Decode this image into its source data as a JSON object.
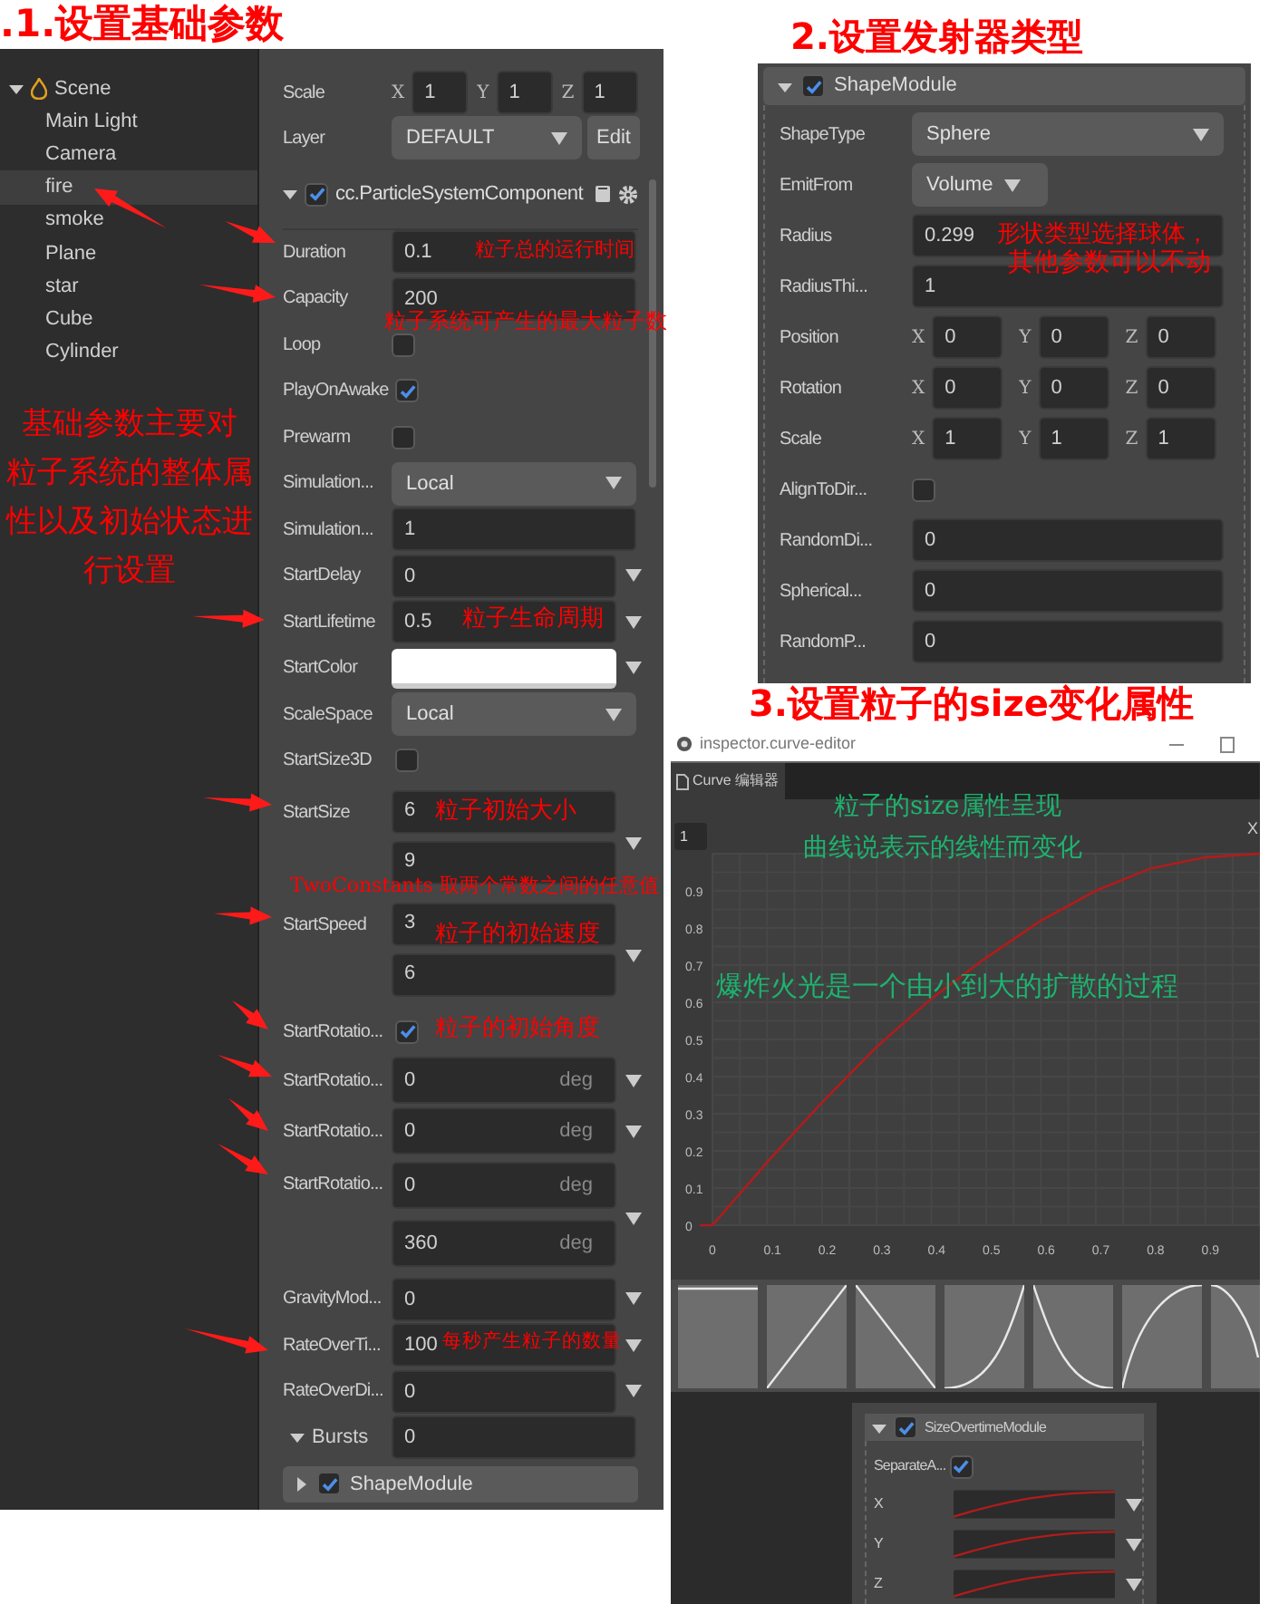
{
  "basic": {
    "title": ".1.设置基础参数",
    "hierarchy": {
      "label": "Scene",
      "expanded": true,
      "children": [
        {
          "label": "Main Light",
          "selected": false
        },
        {
          "label": "Camera",
          "selected": false
        },
        {
          "label": "fire",
          "selected": true
        },
        {
          "label": "smoke",
          "selected": false
        },
        {
          "label": "Plane",
          "selected": false
        },
        {
          "label": "star",
          "selected": false
        },
        {
          "label": "Cube",
          "selected": false
        },
        {
          "label": "Cylinder",
          "selected": false
        }
      ]
    },
    "inspector": {
      "top_rows": [
        {
          "kind": "vector",
          "label": "Scale",
          "axes": [
            {
              "axis": "X",
              "value": "1"
            },
            {
              "axis": "Y",
              "value": "1"
            },
            {
              "axis": "Z",
              "value": "1"
            }
          ]
        },
        {
          "kind": "select",
          "label": "Layer",
          "value": "DEFAULT",
          "button": "Edit"
        }
      ],
      "component": {
        "name": "cc.ParticleSystemComponent",
        "enabled": true,
        "expanded": true
      },
      "rows": [
        {
          "kind": "number",
          "label": "Duration",
          "value": "0.1"
        },
        {
          "kind": "number",
          "label": "Capacity",
          "value": "200"
        },
        {
          "kind": "checkbox",
          "label": "Loop",
          "checked": false
        },
        {
          "kind": "checkbox",
          "label": "PlayOnAwake",
          "checked": true
        },
        {
          "kind": "checkbox",
          "label": "Prewarm",
          "checked": false
        },
        {
          "kind": "select",
          "label": "Simulation...",
          "value": "Local"
        },
        {
          "kind": "number",
          "label": "Simulation...",
          "value": "1"
        },
        {
          "kind": "menu",
          "label": "StartDelay",
          "values": [
            "0"
          ]
        },
        {
          "kind": "menu",
          "label": "StartLifetime",
          "values": [
            "0.5"
          ]
        },
        {
          "kind": "color",
          "label": "StartColor",
          "color": "#ffffff"
        },
        {
          "kind": "select",
          "label": "ScaleSpace",
          "value": "Local"
        },
        {
          "kind": "checkbox",
          "label": "StartSize3D",
          "checked": false
        },
        {
          "kind": "menu",
          "label": "StartSize",
          "values": [
            "6",
            "9"
          ]
        },
        {
          "kind": "menu",
          "label": "StartSpeed",
          "values": [
            "3",
            "6"
          ]
        },
        {
          "kind": "checkbox",
          "label": "StartRotatio...",
          "checked": true
        },
        {
          "kind": "menu",
          "label": "StartRotatio...",
          "values": [
            "0"
          ],
          "units": [
            "deg"
          ]
        },
        {
          "kind": "menu",
          "label": "StartRotatio...",
          "values": [
            "0"
          ],
          "units": [
            "deg"
          ]
        },
        {
          "kind": "menu",
          "label": "StartRotatio...",
          "values": [
            "0",
            "360"
          ],
          "units": [
            "deg",
            "deg"
          ]
        },
        {
          "kind": "menu",
          "label": "GravityMod...",
          "values": [
            "0"
          ]
        },
        {
          "kind": "menu",
          "label": "RateOverTi...",
          "values": [
            "100"
          ]
        },
        {
          "kind": "menu",
          "label": "RateOverDi...",
          "values": [
            "0"
          ]
        },
        {
          "kind": "bursts",
          "label": "Bursts",
          "expanded": true,
          "value": "0"
        },
        {
          "kind": "module",
          "label": "ShapeModule",
          "expanded": false,
          "enabled": true
        }
      ]
    }
  },
  "shape": {
    "title": "2.设置发射器类型",
    "module": {
      "name": "ShapeModule",
      "enabled": true,
      "expanded": true
    },
    "rows": [
      {
        "kind": "select",
        "label": "ShapeType",
        "value": "Sphere"
      },
      {
        "kind": "dropdown",
        "label": "EmitFrom",
        "value": "Volume"
      },
      {
        "kind": "number",
        "label": "Radius",
        "value": "0.299"
      },
      {
        "kind": "number",
        "label": "RadiusThi...",
        "value": "1"
      },
      {
        "kind": "vector",
        "label": "Position",
        "axes": [
          {
            "axis": "X",
            "value": "0"
          },
          {
            "axis": "Y",
            "value": "0"
          },
          {
            "axis": "Z",
            "value": "0"
          }
        ]
      },
      {
        "kind": "vector",
        "label": "Rotation",
        "axes": [
          {
            "axis": "X",
            "value": "0"
          },
          {
            "axis": "Y",
            "value": "0"
          },
          {
            "axis": "Z",
            "value": "0"
          }
        ]
      },
      {
        "kind": "vector",
        "label": "Scale",
        "axes": [
          {
            "axis": "X",
            "value": "1"
          },
          {
            "axis": "Y",
            "value": "1"
          },
          {
            "axis": "Z",
            "value": "1"
          }
        ]
      },
      {
        "kind": "checkbox",
        "label": "AlignToDir...",
        "checked": false
      },
      {
        "kind": "number",
        "label": "RandomDi...",
        "value": "0"
      },
      {
        "kind": "number",
        "label": "Spherical...",
        "value": "0"
      },
      {
        "kind": "number",
        "label": "RandomP...",
        "value": "0"
      }
    ]
  },
  "curve": {
    "title": "3.设置粒子的size变化属性",
    "window_title": "inspector.curve-editor",
    "tab": "Curve 编辑器",
    "max_value": "1",
    "close": "X",
    "chart_data": {
      "type": "line",
      "x": [
        0,
        0.1,
        0.2,
        0.3,
        0.4,
        0.5,
        0.6,
        0.7,
        0.8,
        0.9,
        1
      ],
      "series": [
        {
          "color": "#b01c1c",
          "values": [
            0,
            0.17,
            0.33,
            0.48,
            0.61,
            0.72,
            0.82,
            0.9,
            0.96,
            0.99,
            1
          ]
        }
      ],
      "xlim": [
        0,
        1
      ],
      "ylim": [
        0,
        1
      ],
      "xticks": [
        0,
        0.1,
        0.2,
        0.3,
        0.4,
        0.5,
        0.6,
        0.7,
        0.8,
        0.9
      ],
      "yticks": [
        0,
        0.1,
        0.2,
        0.3,
        0.4,
        0.5,
        0.6,
        0.7,
        0.8,
        0.9
      ],
      "grid": true
    },
    "module": {
      "name": "SizeOvertimeModule",
      "enabled": true,
      "expanded": true,
      "separate": {
        "label": "SeparateA...",
        "checked": true
      },
      "axes": [
        {
          "label": "X"
        },
        {
          "label": "Y"
        },
        {
          "label": "Z"
        }
      ]
    }
  },
  "annotations": [
    {
      "text": "粒子总的运行时间",
      "color": "#ff0000"
    },
    {
      "text": "粒子系统可产生的最大粒子数",
      "color": "#ff0000"
    },
    {
      "text": "基础参数主要对",
      "color": "#ff0000"
    },
    {
      "text": "粒子系统的整体属",
      "color": "#ff0000"
    },
    {
      "text": "性以及初始状态进",
      "color": "#ff0000"
    },
    {
      "text": "行设置",
      "color": "#ff0000"
    },
    {
      "text": "粒子生命周期",
      "color": "#ff0000"
    },
    {
      "text": "粒子初始大小",
      "color": "#ff0000"
    },
    {
      "text": "TwoConstants 取两个常数之间的任意值",
      "color": "#ff0000"
    },
    {
      "text": "粒子的初始速度",
      "color": "#ff0000"
    },
    {
      "text": "粒子的初始角度",
      "color": "#ff0000"
    },
    {
      "text": "每秒产生粒子的数量",
      "color": "#ff0000"
    },
    {
      "text": "形状类型选择球体，",
      "color": "#ff0000"
    },
    {
      "text": "其他参数可以不动",
      "color": "#ff0000"
    },
    {
      "text": "粒子的size属性呈现",
      "color": "#1db36f"
    },
    {
      "text": "曲线说表示的线性而变化",
      "color": "#1db36f"
    },
    {
      "text": "爆炸火光是一个由小到大的扩散的过程",
      "color": "#1db36f"
    }
  ]
}
